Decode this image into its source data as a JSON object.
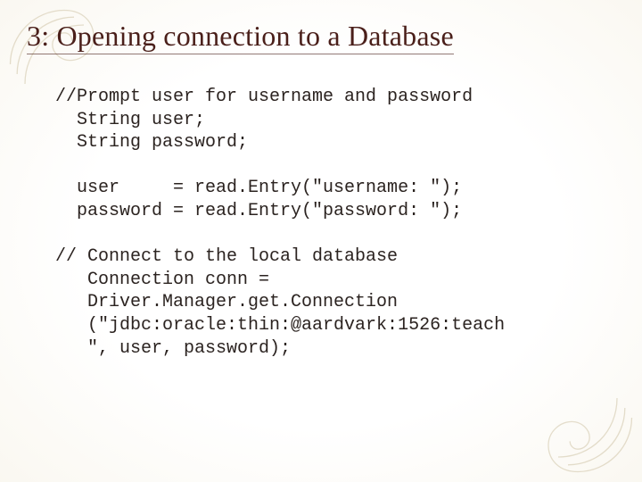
{
  "slide": {
    "title": "3: Opening connection to a Database",
    "code_block1_l1": "//Prompt user for username and password",
    "code_block1_l2": "  String user;",
    "code_block1_l3": "  String password;",
    "code_block2_l1": "  user     = read.Entry(\"username: \");",
    "code_block2_l2": "  password = read.Entry(\"password: \");",
    "code_block3_l1": "// Connect to the local database",
    "code_block3_l2": "   Connection conn =",
    "code_block3_l3": "   Driver.Manager.get.Connection",
    "code_block3_l4": "   (\"jdbc:oracle:thin:@aardvark:1526:teach",
    "code_block3_l5": "   \", user, password);"
  }
}
